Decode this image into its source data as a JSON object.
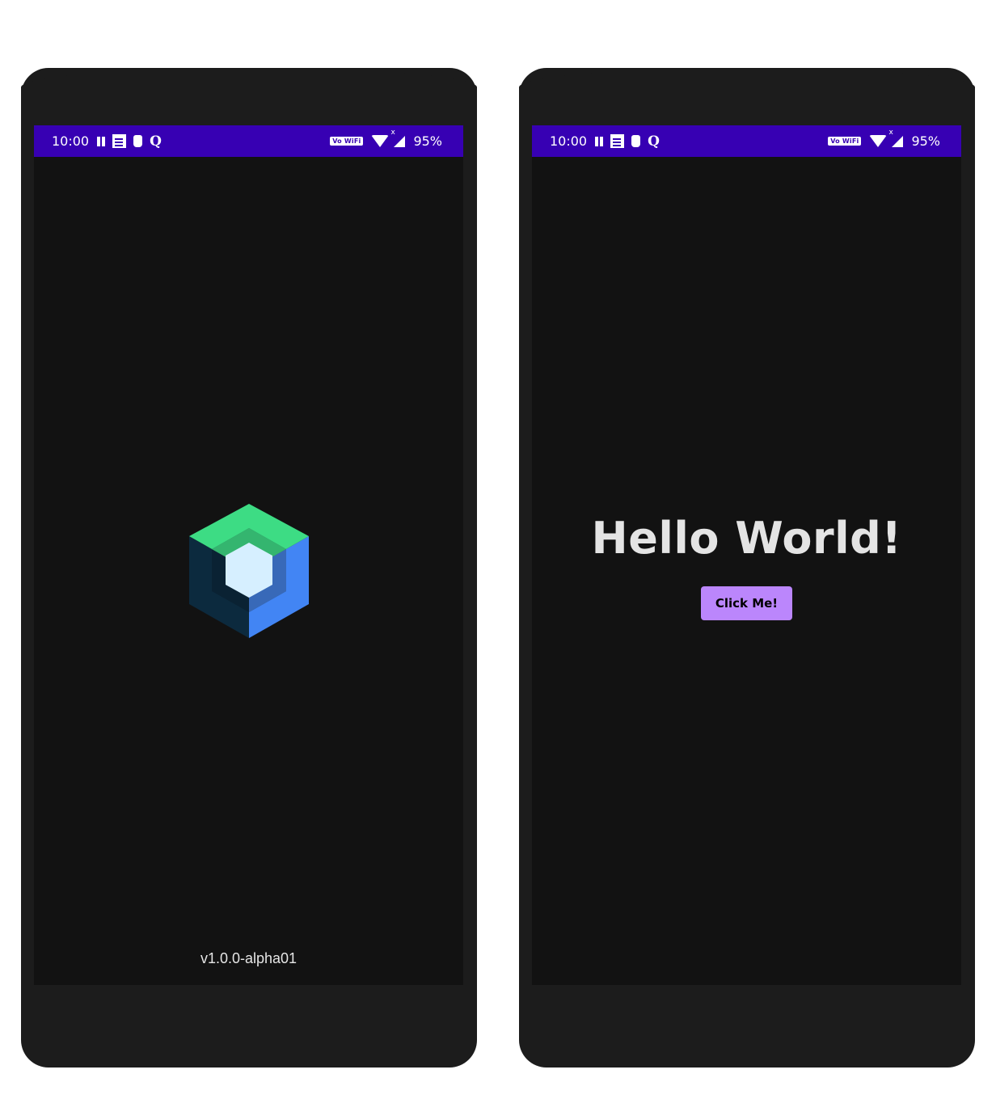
{
  "colors": {
    "status_bar": "#3700b3",
    "screen_bg": "#121212",
    "phone_frame": "#1c1c1c",
    "button_bg": "#bb86fc",
    "logo_green": "#3ddc84",
    "logo_blue": "#4285f4",
    "logo_dark": "#0c2a3e",
    "logo_center": "#d6efff"
  },
  "left_phone": {
    "status_bar": {
      "time": "10:00",
      "vowifi": "Vo WiFi",
      "signal_x": "x",
      "battery": "95%",
      "icons": [
        "pause-icon",
        "news-icon",
        "gift-icon",
        "q-icon",
        "vowifi-icon",
        "wifi-icon",
        "signal-icon"
      ]
    },
    "logo_icon": "jetpack-compose-logo",
    "version": "v1.0.0-alpha01"
  },
  "right_phone": {
    "status_bar": {
      "time": "10:00",
      "vowifi": "Vo WiFi",
      "signal_x": "x",
      "battery": "95%",
      "icons": [
        "pause-icon",
        "news-icon",
        "gift-icon",
        "q-icon",
        "vowifi-icon",
        "wifi-icon",
        "signal-icon"
      ]
    },
    "greeting": "Hello World!",
    "button_label": "Click Me!"
  }
}
